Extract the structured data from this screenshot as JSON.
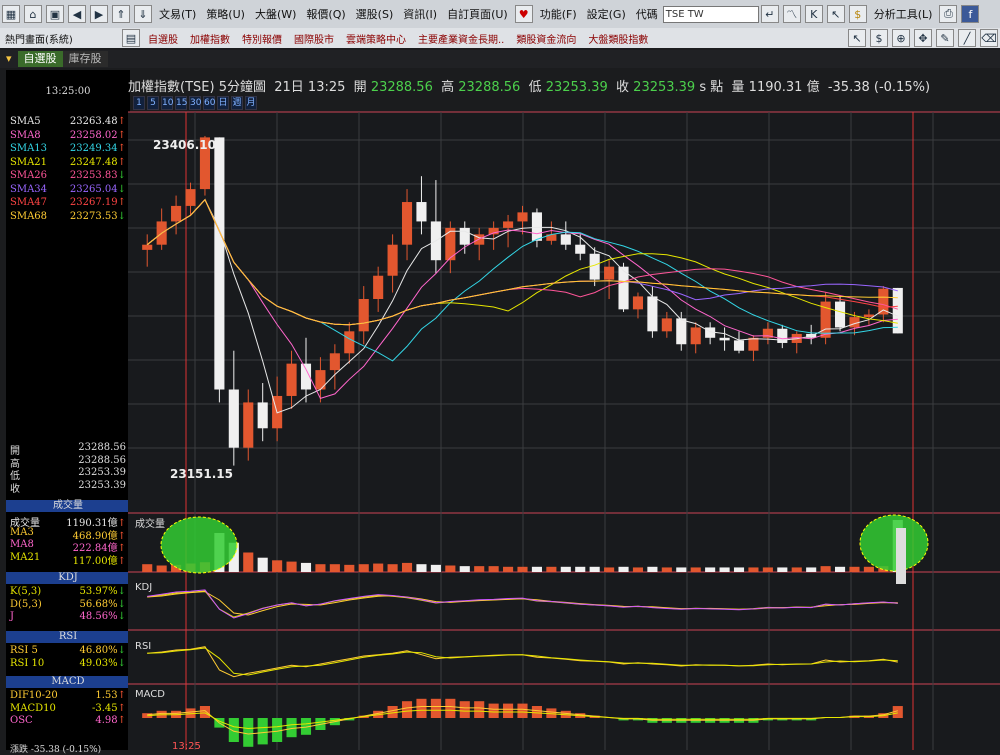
{
  "menubar": {
    "items": [
      "文易(T)",
      "策略(U)",
      "大盤(W)",
      "報價(Q)",
      "選股(S)",
      "資訊(I)",
      "自訂頁面(U)",
      "功能(F)",
      "設定(G)",
      "代碼"
    ],
    "code_value": "TSE TW",
    "analysis_label": "分析工具(L)"
  },
  "toolbar": {
    "layout": "熱門畫面(系統)",
    "items": [
      "自選股",
      "加權指數",
      "特別報價",
      "國際股市",
      "雲端策略中心",
      "主要產業資金長期..",
      "類股資金流向",
      "大盤類股指數"
    ]
  },
  "tabs": {
    "items": [
      "自選股",
      "庫存股"
    ]
  },
  "header": {
    "name": "加權指數(TSE)",
    "period": "5分鐘圖",
    "time": "21日 13:25",
    "open_label": "開",
    "open": "23288.56",
    "high_label": "高",
    "high": "23288.56",
    "low_label": "低",
    "low": "23253.39",
    "close_label": "收",
    "close": "23253.39",
    "s_label": "s 點",
    "vol_label": "量",
    "volume": "1190.31 億",
    "change": "-35.38 (-0.15%)"
  },
  "periods": [
    "1",
    "5",
    "10",
    "15",
    "30",
    "60",
    "日",
    "週",
    "月"
  ],
  "left": {
    "time": "13:25:00",
    "sma": [
      {
        "name": "SMA5",
        "value": "23263.48",
        "arrow": "↑",
        "color": "#e8e8e8"
      },
      {
        "name": "SMA8",
        "value": "23258.02",
        "arrow": "↑",
        "color": "#ff66cc"
      },
      {
        "name": "SMA13",
        "value": "23249.34",
        "arrow": "↑",
        "color": "#33d6e6"
      },
      {
        "name": "SMA21",
        "value": "23247.48",
        "arrow": "↑",
        "color": "#e6e600"
      },
      {
        "name": "SMA26",
        "value": "23253.83",
        "arrow": "↓",
        "color": "#ff5599"
      },
      {
        "name": "SMA34",
        "value": "23265.04",
        "arrow": "↓",
        "color": "#9966ff"
      },
      {
        "name": "SMA47",
        "value": "23267.19",
        "arrow": "↑",
        "color": "#ff4444"
      },
      {
        "name": "SMA68",
        "value": "23273.53",
        "arrow": "↓",
        "color": "#ffcc33"
      }
    ],
    "ohlc": [
      {
        "label": "開",
        "value": "23288.56"
      },
      {
        "label": "高",
        "value": "23288.56"
      },
      {
        "label": "低",
        "value": "23253.39"
      },
      {
        "label": "收",
        "value": "23253.39"
      }
    ],
    "vol_title": "成交量",
    "vol": [
      {
        "label": "成交量",
        "value": "1190.31億",
        "arrow": "↑",
        "color": "#e8e8e8"
      },
      {
        "label": "MA3",
        "value": "468.90億",
        "arrow": "↑",
        "color": "#ffcc33"
      },
      {
        "label": "MA8",
        "value": "222.84億",
        "arrow": "↑",
        "color": "#ff66cc"
      },
      {
        "label": "MA21",
        "value": "117.00億",
        "arrow": "↑",
        "color": "#e6e600"
      }
    ],
    "kdj_title": "KDJ",
    "kdj": [
      {
        "label": "K(5,3)",
        "value": "53.97%",
        "arrow": "↓",
        "color": "#e6e600"
      },
      {
        "label": "D(5,3)",
        "value": "56.68%",
        "arrow": "↓",
        "color": "#ffcc33"
      },
      {
        "label": "J",
        "value": "48.56%",
        "arrow": "↓",
        "color": "#ff66cc"
      }
    ],
    "rsi_title": "RSI",
    "rsi": [
      {
        "label": "RSI 5",
        "value": "46.80%",
        "arrow": "↓",
        "color": "#ffcc33"
      },
      {
        "label": "RSI 10",
        "value": "49.03%",
        "arrow": "↓",
        "color": "#e6e600"
      }
    ],
    "macd_title": "MACD",
    "macd": [
      {
        "label": "DIF10-20",
        "value": "1.53",
        "arrow": "↑",
        "color": "#ffcc33"
      },
      {
        "label": "MACD10",
        "value": "-3.45",
        "arrow": "↑",
        "color": "#e6e600"
      },
      {
        "label": "OSC",
        "value": "4.98",
        "arrow": "↑",
        "color": "#ff66cc"
      }
    ],
    "bottom": "漲跌 -35.38 (-0.15%)"
  },
  "chart_data": {
    "type": "candlestick",
    "annotations": {
      "high_label": "23406.10",
      "low_label": "23151.15",
      "cursor_time": "13:25"
    },
    "ylim": [
      23140,
      23420
    ],
    "candles": [
      [
        23318,
        23330,
        23305,
        23322
      ],
      [
        23322,
        23350,
        23318,
        23340
      ],
      [
        23340,
        23360,
        23330,
        23352
      ],
      [
        23352,
        23370,
        23345,
        23365
      ],
      [
        23365,
        23406.1,
        23360,
        23405
      ],
      [
        23405,
        23405,
        23200,
        23210
      ],
      [
        23210,
        23240,
        23151.15,
        23165
      ],
      [
        23165,
        23210,
        23155,
        23200
      ],
      [
        23200,
        23215,
        23170,
        23180
      ],
      [
        23180,
        23220,
        23170,
        23205
      ],
      [
        23205,
        23240,
        23195,
        23230
      ],
      [
        23230,
        23250,
        23200,
        23210
      ],
      [
        23210,
        23235,
        23200,
        23225
      ],
      [
        23225,
        23245,
        23210,
        23238
      ],
      [
        23238,
        23262,
        23230,
        23255
      ],
      [
        23255,
        23290,
        23245,
        23280
      ],
      [
        23280,
        23305,
        23270,
        23298
      ],
      [
        23298,
        23330,
        23285,
        23322
      ],
      [
        23322,
        23365,
        23310,
        23355
      ],
      [
        23355,
        23375,
        23330,
        23340
      ],
      [
        23340,
        23372,
        23300,
        23310
      ],
      [
        23310,
        23340,
        23300,
        23335
      ],
      [
        23335,
        23340,
        23315,
        23322
      ],
      [
        23322,
        23335,
        23310,
        23330
      ],
      [
        23330,
        23340,
        23318,
        23335
      ],
      [
        23335,
        23345,
        23320,
        23340
      ],
      [
        23340,
        23352,
        23330,
        23347
      ],
      [
        23347,
        23350,
        23320,
        23325
      ],
      [
        23325,
        23340,
        23322,
        23330
      ],
      [
        23330,
        23340,
        23318,
        23322
      ],
      [
        23322,
        23330,
        23310,
        23315
      ],
      [
        23315,
        23320,
        23290,
        23295
      ],
      [
        23295,
        23310,
        23280,
        23305
      ],
      [
        23305,
        23308,
        23270,
        23272
      ],
      [
        23272,
        23285,
        23265,
        23282
      ],
      [
        23282,
        23290,
        23250,
        23255
      ],
      [
        23255,
        23270,
        23250,
        23265
      ],
      [
        23265,
        23270,
        23240,
        23245
      ],
      [
        23245,
        23262,
        23238,
        23258
      ],
      [
        23258,
        23262,
        23245,
        23250
      ],
      [
        23250,
        23258,
        23240,
        23248
      ],
      [
        23248,
        23255,
        23238,
        23240
      ],
      [
        23240,
        23252,
        23232,
        23250
      ],
      [
        23250,
        23262,
        23245,
        23257
      ],
      [
        23257,
        23260,
        23242,
        23246
      ],
      [
        23246,
        23255,
        23238,
        23253
      ],
      [
        23253,
        23260,
        23245,
        23250
      ],
      [
        23250,
        23285,
        23245,
        23278
      ],
      [
        23278,
        23282,
        23255,
        23258
      ],
      [
        23258,
        23270,
        23252,
        23266
      ],
      [
        23266,
        23272,
        23260,
        23268
      ],
      [
        23268,
        23290,
        23262,
        23288
      ],
      [
        23288.56,
        23288.56,
        23253.39,
        23253.39
      ]
    ],
    "volume": [
      12,
      10,
      11,
      13,
      15,
      60,
      45,
      30,
      22,
      18,
      16,
      14,
      12,
      12,
      11,
      12,
      13,
      12,
      14,
      12,
      11,
      10,
      9,
      9,
      9,
      8,
      8,
      8,
      8,
      8,
      8,
      8,
      7,
      8,
      7,
      8,
      7,
      7,
      7,
      7,
      7,
      7,
      7,
      7,
      7,
      7,
      7,
      9,
      8,
      8,
      8,
      9,
      1190.31
    ],
    "kdj_k": [
      70,
      75,
      80,
      82,
      85,
      40,
      20,
      30,
      42,
      50,
      55,
      48,
      52,
      60,
      65,
      70,
      74,
      72,
      68,
      62,
      55,
      58,
      60,
      62,
      63,
      65,
      66,
      60,
      58,
      55,
      52,
      50,
      48,
      45,
      47,
      44,
      42,
      40,
      42,
      41,
      40,
      39,
      41,
      44,
      43,
      45,
      44,
      52,
      50,
      53,
      55,
      57,
      53.97
    ],
    "rsi": [
      60,
      62,
      65,
      66,
      70,
      35,
      25,
      30,
      34,
      38,
      42,
      40,
      44,
      48,
      52,
      56,
      58,
      60,
      64,
      58,
      52,
      54,
      55,
      56,
      57,
      58,
      58,
      54,
      53,
      51,
      49,
      48,
      47,
      44,
      46,
      44,
      43,
      41,
      43,
      42,
      42,
      41,
      42,
      44,
      43,
      44,
      44,
      50,
      47,
      48,
      49,
      51,
      46.8
    ],
    "macd_osc": [
      2,
      3,
      3,
      4,
      5,
      -4,
      -10,
      -12,
      -11,
      -10,
      -8,
      -7,
      -5,
      -3,
      -1,
      1,
      3,
      5,
      7,
      8,
      8,
      8,
      7,
      7,
      6,
      6,
      6,
      5,
      4,
      3,
      2,
      1,
      0,
      -1,
      -1,
      -2,
      -2,
      -2,
      -2,
      -2,
      -2,
      -2,
      -2,
      -1,
      -1,
      -1,
      -1,
      0,
      0,
      1,
      1,
      2,
      4.98
    ]
  }
}
